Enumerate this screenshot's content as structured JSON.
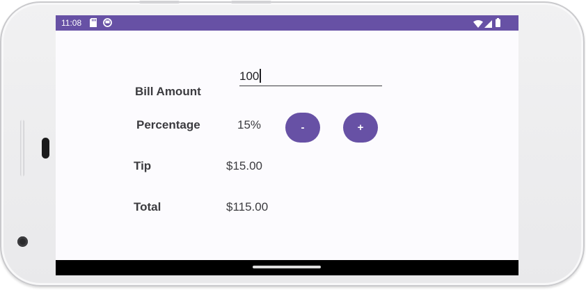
{
  "status_bar": {
    "time": "11:08",
    "left_icons": [
      "sd-card-icon",
      "notification-icon"
    ],
    "right_icons": [
      "wifi-icon",
      "signal-icon",
      "battery-icon"
    ]
  },
  "form": {
    "bill_label": "Bill Amount",
    "bill_value": "100",
    "percentage_label": "Percentage",
    "percentage_value": "15%",
    "decrement_label": "-",
    "increment_label": "+",
    "tip_label": "Tip",
    "tip_value": "$15.00",
    "total_label": "Total",
    "total_value": "$115.00"
  },
  "colors": {
    "accent": "#6751a5",
    "text": "#3b3b3f",
    "screen_background": "#fcfbfe"
  }
}
